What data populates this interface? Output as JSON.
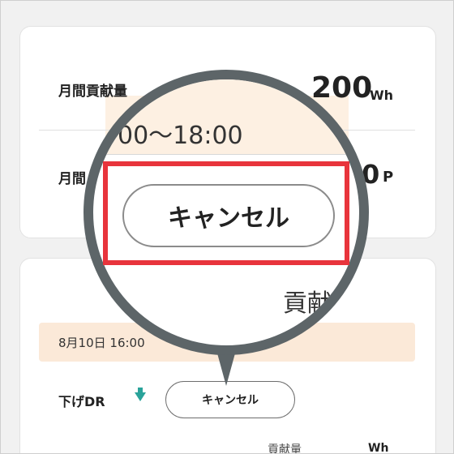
{
  "summary": {
    "monthly_contribution_label": "月間貢献量",
    "monthly_contribution_value": "200",
    "monthly_contribution_unit": "Wh",
    "monthly_points_label_partial": "月間",
    "monthly_points_value_partial": "0",
    "monthly_points_unit": "P"
  },
  "event": {
    "date_time_partial": "8月10日 16:00",
    "dr_type_label": "下げDR",
    "cancel_button_label": "キャンセル",
    "contribution_label": "貢献量",
    "contribution_unit": "Wh"
  },
  "magnifier": {
    "time_range_partial": "00〜18:00",
    "cancel_button_label": "キャンセル",
    "contribution_label_partial": "貢献"
  },
  "colors": {
    "highlight": "#e8343c",
    "magnifier_rim": "#5d6568",
    "peach": "#fbe9d8",
    "dr_arrow": "#2aa39a"
  }
}
